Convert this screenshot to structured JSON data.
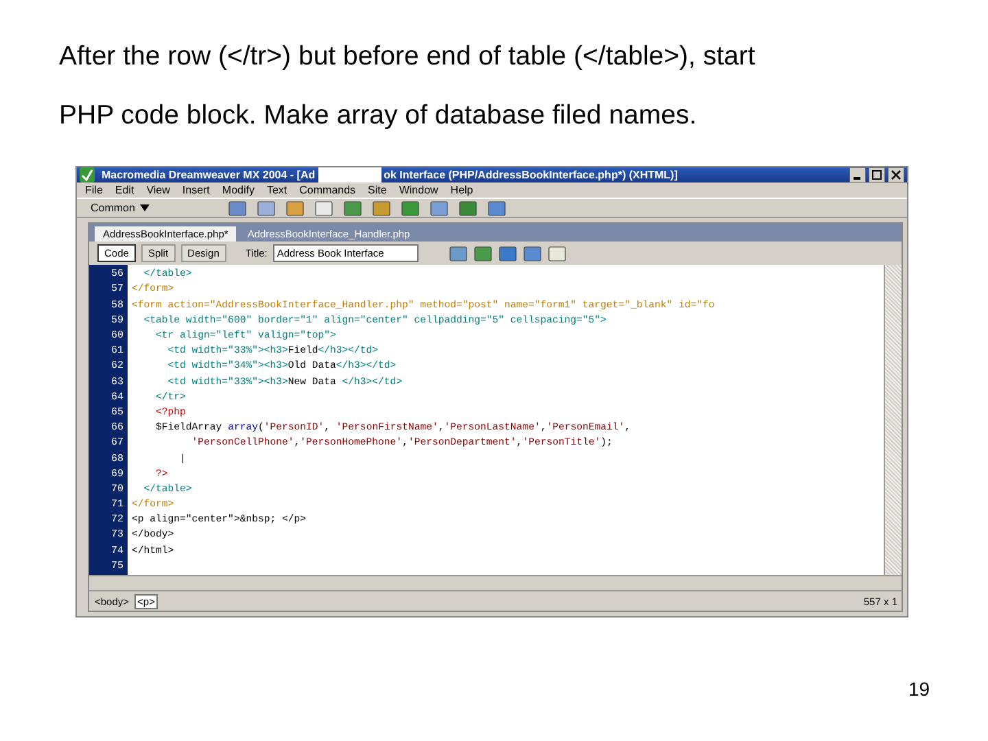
{
  "slide": {
    "caption": [
      "After the row (</tr>) but before end of table (</table>), start",
      "PHP code block.  Make array of database filed names."
    ],
    "page_number": "19"
  },
  "window": {
    "title_start": "Macromedia Dreamweaver MX 2004 - [Ad",
    "title_end": "ok Interface (PHP/AddressBookInterface.php*) (XHTML)]"
  },
  "menu": [
    "File",
    "Edit",
    "View",
    "Insert",
    "Modify",
    "Text",
    "Commands",
    "Site",
    "Window",
    "Help"
  ],
  "insert_bar": {
    "category": "Common"
  },
  "document_tabs": [
    {
      "label": "AddressBookInterface.php*",
      "selected": true
    },
    {
      "label": "AddressBookInterface_Handler.php",
      "selected": false
    }
  ],
  "view_buttons": [
    {
      "label": "Code",
      "selected": true
    },
    {
      "label": "Split",
      "selected": false
    },
    {
      "label": "Design",
      "selected": false
    }
  ],
  "title_field": {
    "label": "Title:",
    "value": "Address Book Interface"
  },
  "code_lines": [
    {
      "number": "56",
      "segments": [
        {
          "kind": "tag",
          "text": "  </table>"
        }
      ]
    },
    {
      "number": "57",
      "segments": [
        {
          "kind": "form",
          "text": "</form>"
        }
      ]
    },
    {
      "number": "58",
      "segments": [
        {
          "kind": "form",
          "text": "<form action=\"AddressBookInterface_Handler.php\" method=\"post\" name=\"form1\" target=\"_blank\" id=\"fo"
        }
      ]
    },
    {
      "number": "59",
      "segments": [
        {
          "kind": "tag",
          "text": "  <table width=\"600\" border=\"1\" align=\"center\" cellpadding=\"5\" cellspacing=\"5\">"
        }
      ]
    },
    {
      "number": "60",
      "segments": [
        {
          "kind": "tag",
          "text": "    <tr align=\"left\" valign=\"top\">"
        }
      ]
    },
    {
      "number": "61",
      "segments": [
        {
          "kind": "tag",
          "text": "      <td width=\"33%\"><h3>"
        },
        {
          "kind": "plain",
          "text": "Field"
        },
        {
          "kind": "tag",
          "text": "</h3></td>"
        }
      ]
    },
    {
      "number": "62",
      "segments": [
        {
          "kind": "tag",
          "text": "      <td width=\"34%\"><h3>"
        },
        {
          "kind": "plain",
          "text": "Old Data"
        },
        {
          "kind": "tag",
          "text": "</h3></td>"
        }
      ]
    },
    {
      "number": "63",
      "segments": [
        {
          "kind": "tag",
          "text": "      <td width=\"33%\"><h3>"
        },
        {
          "kind": "plain",
          "text": "New Data "
        },
        {
          "kind": "tag",
          "text": "</h3></td>"
        }
      ]
    },
    {
      "number": "64",
      "segments": [
        {
          "kind": "tag",
          "text": "    </tr>"
        }
      ]
    },
    {
      "number": "65",
      "segments": [
        {
          "kind": "php",
          "text": "    <?php"
        }
      ]
    },
    {
      "number": "66",
      "segments": [
        {
          "kind": "plain",
          "text": "    $FieldArray "
        },
        {
          "kind": "keyword",
          "text": "array"
        },
        {
          "kind": "plain",
          "text": "("
        },
        {
          "kind": "string",
          "text": "'PersonID'"
        },
        {
          "kind": "plain",
          "text": ", "
        },
        {
          "kind": "string",
          "text": "'PersonFirstName'"
        },
        {
          "kind": "plain",
          "text": ","
        },
        {
          "kind": "string",
          "text": "'PersonLastName'"
        },
        {
          "kind": "plain",
          "text": ","
        },
        {
          "kind": "string",
          "text": "'PersonEmail'"
        },
        {
          "kind": "plain",
          "text": ","
        }
      ]
    },
    {
      "number": "67",
      "segments": [
        {
          "kind": "string",
          "text": "          'PersonCellPhone'"
        },
        {
          "kind": "plain",
          "text": ","
        },
        {
          "kind": "string",
          "text": "'PersonHomePhone'"
        },
        {
          "kind": "plain",
          "text": ","
        },
        {
          "kind": "string",
          "text": "'PersonDepartment'"
        },
        {
          "kind": "plain",
          "text": ","
        },
        {
          "kind": "string",
          "text": "'PersonTitle'"
        },
        {
          "kind": "plain",
          "text": ");"
        }
      ]
    },
    {
      "number": "68",
      "segments": [
        {
          "kind": "plain",
          "text": "        |"
        }
      ]
    },
    {
      "number": "69",
      "segments": [
        {
          "kind": "php",
          "text": "    ?>"
        }
      ]
    },
    {
      "number": "70",
      "segments": [
        {
          "kind": "tag",
          "text": "  </table>"
        }
      ]
    },
    {
      "number": "71",
      "segments": [
        {
          "kind": "form",
          "text": "</form>"
        }
      ]
    },
    {
      "number": "72",
      "segments": [
        {
          "kind": "plain",
          "text": "<p align=\"center\">&nbsp; </p>"
        }
      ]
    },
    {
      "number": "73",
      "segments": [
        {
          "kind": "plain",
          "text": "</body>"
        }
      ]
    },
    {
      "number": "74",
      "segments": [
        {
          "kind": "plain",
          "text": "</html>"
        }
      ]
    },
    {
      "number": "75"
    }
  ],
  "status_bar": {
    "tags": [
      {
        "label": "<body>",
        "selected": false
      },
      {
        "label": "<p>",
        "selected": true
      }
    ],
    "size": "557 x 1"
  }
}
